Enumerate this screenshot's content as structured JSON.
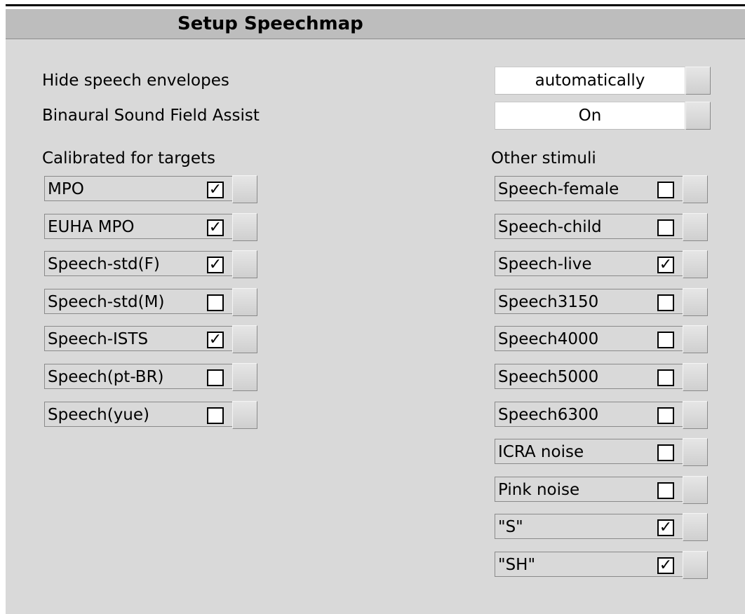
{
  "window": {
    "title": "Setup Speechmap"
  },
  "options": {
    "hide_envelopes": {
      "label": "Hide speech envelopes",
      "value": "automatically"
    },
    "binaural": {
      "label": "Binaural Sound Field Assist",
      "value": "On"
    }
  },
  "calibrated": {
    "heading": "Calibrated for targets",
    "items": [
      {
        "label": "MPO",
        "checked": true
      },
      {
        "label": "EUHA MPO",
        "checked": true
      },
      {
        "label": "Speech-std(F)",
        "checked": true
      },
      {
        "label": "Speech-std(M)",
        "checked": false
      },
      {
        "label": "Speech-ISTS",
        "checked": true
      },
      {
        "label": "Speech(pt-BR)",
        "checked": false
      },
      {
        "label": "Speech(yue)",
        "checked": false
      }
    ]
  },
  "other": {
    "heading": "Other stimuli",
    "items": [
      {
        "label": "Speech-female",
        "checked": false
      },
      {
        "label": "Speech-child",
        "checked": false
      },
      {
        "label": "Speech-live",
        "checked": true
      },
      {
        "label": "Speech3150",
        "checked": false
      },
      {
        "label": "Speech4000",
        "checked": false
      },
      {
        "label": "Speech5000",
        "checked": false
      },
      {
        "label": "Speech6300",
        "checked": false
      },
      {
        "label": "ICRA noise",
        "checked": false
      },
      {
        "label": "Pink noise",
        "checked": false
      },
      {
        "label": "\"S\"",
        "checked": true
      },
      {
        "label": "\"SH\"",
        "checked": true
      }
    ]
  },
  "checkmark_glyph": "✓"
}
